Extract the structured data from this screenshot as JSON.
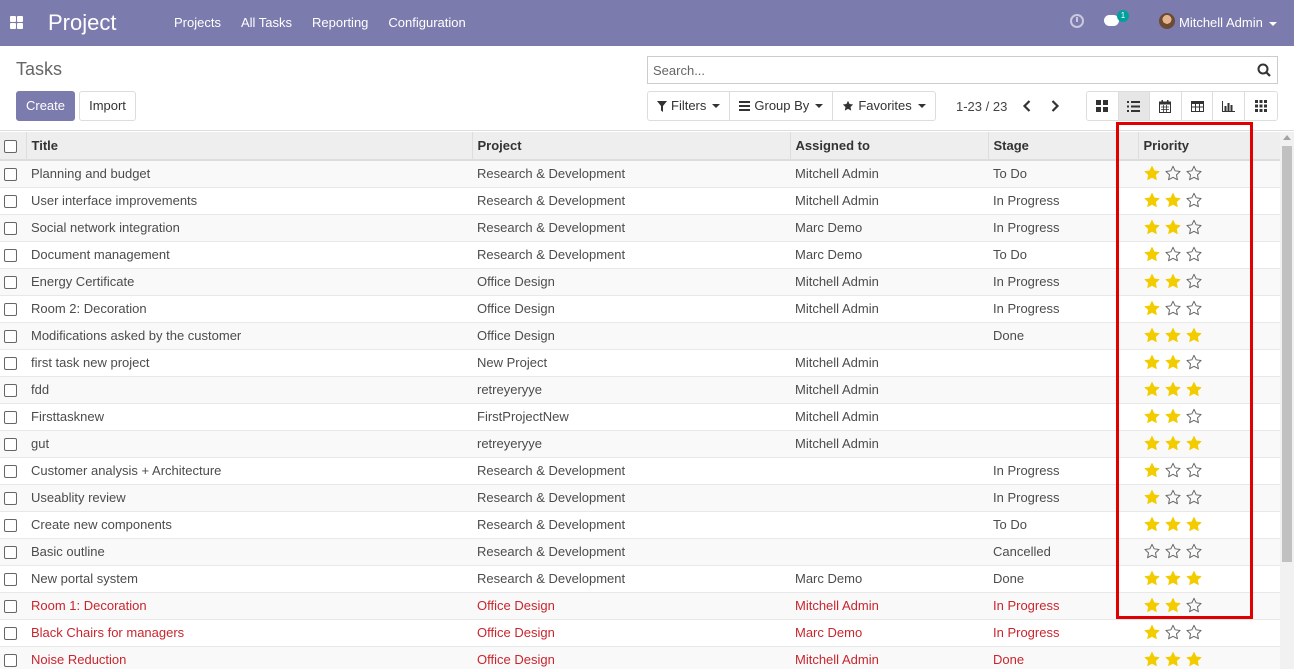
{
  "navbar": {
    "app_name": "Project",
    "menu": [
      "Projects",
      "All Tasks",
      "Reporting",
      "Configuration"
    ],
    "chat_count": "1",
    "user_name": "Mitchell Admin",
    "bg_color": "#7c7bad"
  },
  "control_panel": {
    "breadcrumb": "Tasks",
    "create_label": "Create",
    "import_label": "Import",
    "search_placeholder": "Search...",
    "filters_label": "Filters",
    "group_by_label": "Group By",
    "favorites_label": "Favorites",
    "pager": "1-23 / 23",
    "views": [
      "kanban-icon",
      "list-icon",
      "calendar-icon",
      "pivot-icon",
      "graph-icon",
      "activity-icon"
    ],
    "active_view": "list-icon"
  },
  "table": {
    "columns": [
      "Title",
      "Project",
      "Assigned to",
      "Stage",
      "Priority"
    ],
    "rows": [
      {
        "title": "Planning and budget",
        "project": "Research & Development",
        "assigned": "Mitchell Admin",
        "stage": "To Do",
        "priority": 1,
        "overdue": false
      },
      {
        "title": "User interface improvements",
        "project": "Research & Development",
        "assigned": "Mitchell Admin",
        "stage": "In Progress",
        "priority": 2,
        "overdue": false
      },
      {
        "title": "Social network integration",
        "project": "Research & Development",
        "assigned": "Marc Demo",
        "stage": "In Progress",
        "priority": 2,
        "overdue": false
      },
      {
        "title": "Document management",
        "project": "Research & Development",
        "assigned": "Marc Demo",
        "stage": "To Do",
        "priority": 1,
        "overdue": false
      },
      {
        "title": "Energy Certificate",
        "project": "Office Design",
        "assigned": "Mitchell Admin",
        "stage": "In Progress",
        "priority": 2,
        "overdue": false
      },
      {
        "title": "Room 2: Decoration",
        "project": "Office Design",
        "assigned": "Mitchell Admin",
        "stage": "In Progress",
        "priority": 1,
        "overdue": false
      },
      {
        "title": "Modifications asked by the customer",
        "project": "Office Design",
        "assigned": "",
        "stage": "Done",
        "priority": 3,
        "overdue": false
      },
      {
        "title": "first task new project",
        "project": "New Project",
        "assigned": "Mitchell Admin",
        "stage": "",
        "priority": 2,
        "overdue": false
      },
      {
        "title": "fdd",
        "project": "retreyeryye",
        "assigned": "Mitchell Admin",
        "stage": "",
        "priority": 3,
        "overdue": false
      },
      {
        "title": "Firsttasknew",
        "project": "FirstProjectNew",
        "assigned": "Mitchell Admin",
        "stage": "",
        "priority": 2,
        "overdue": false
      },
      {
        "title": "gut",
        "project": "retreyeryye",
        "assigned": "Mitchell Admin",
        "stage": "",
        "priority": 3,
        "overdue": false
      },
      {
        "title": "Customer analysis + Architecture",
        "project": "Research & Development",
        "assigned": "",
        "stage": "In Progress",
        "priority": 1,
        "overdue": false
      },
      {
        "title": "Useablity review",
        "project": "Research & Development",
        "assigned": "",
        "stage": "In Progress",
        "priority": 1,
        "overdue": false
      },
      {
        "title": "Create new components",
        "project": "Research & Development",
        "assigned": "",
        "stage": "To Do",
        "priority": 3,
        "overdue": false
      },
      {
        "title": "Basic outline",
        "project": "Research & Development",
        "assigned": "",
        "stage": "Cancelled",
        "priority": 0,
        "overdue": false
      },
      {
        "title": "New portal system",
        "project": "Research & Development",
        "assigned": "Marc Demo",
        "stage": "Done",
        "priority": 3,
        "overdue": false
      },
      {
        "title": "Room 1: Decoration",
        "project": "Office Design",
        "assigned": "Mitchell Admin",
        "stage": "In Progress",
        "priority": 2,
        "overdue": true
      },
      {
        "title": "Black Chairs for managers",
        "project": "Office Design",
        "assigned": "Marc Demo",
        "stage": "In Progress",
        "priority": 1,
        "overdue": true
      },
      {
        "title": "Noise Reduction",
        "project": "Office Design",
        "assigned": "Mitchell Admin",
        "stage": "Done",
        "priority": 3,
        "overdue": true
      }
    ],
    "star_color": "#f3cc00",
    "overdue_color": "#c8262e"
  }
}
